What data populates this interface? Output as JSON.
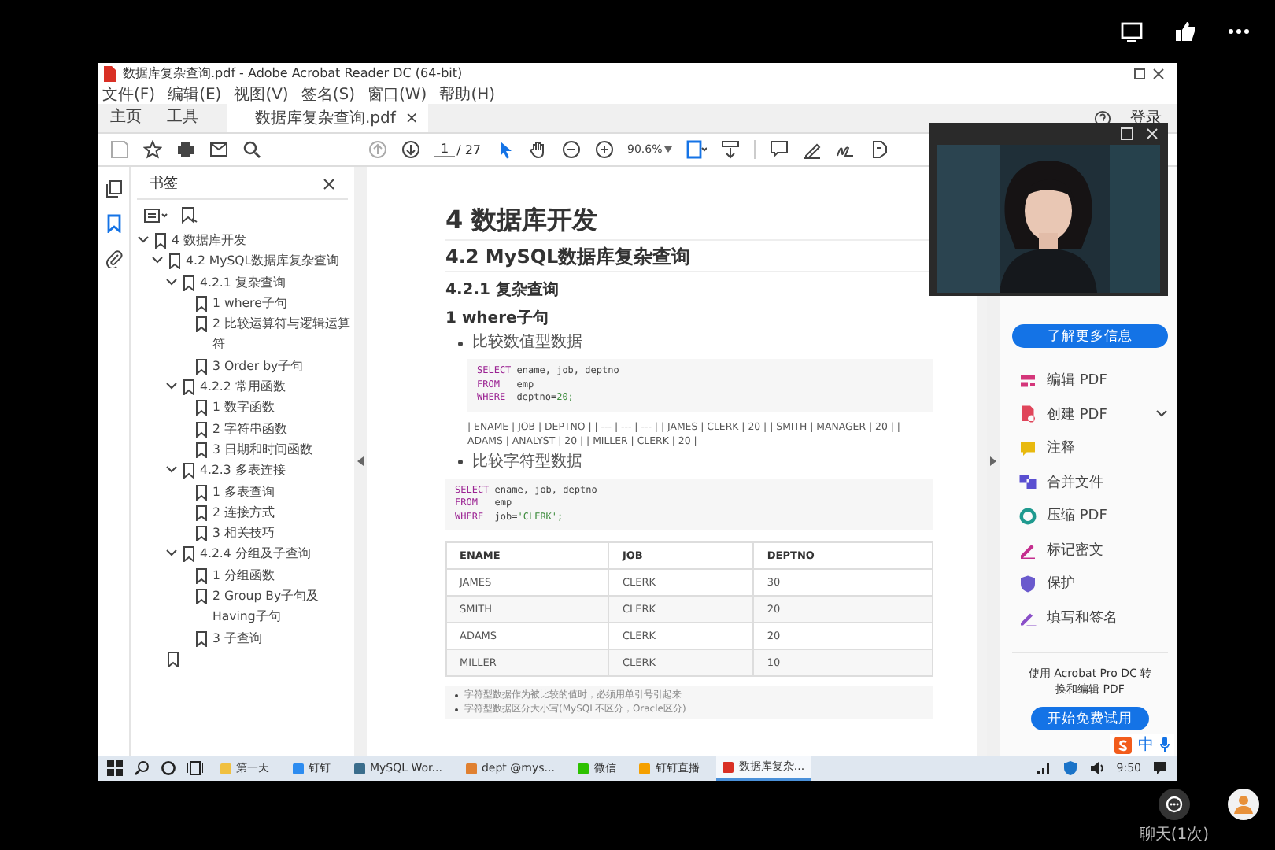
{
  "window": {
    "title": "数据库复杂查询.pdf - Adobe Acrobat Reader DC (64-bit)"
  },
  "menu": [
    "文件(F)",
    "编辑(E)",
    "视图(V)",
    "签名(S)",
    "窗口(W)",
    "帮助(H)"
  ],
  "tabs": [
    {
      "label": "主页",
      "selected": false
    },
    {
      "label": "工具",
      "selected": false
    }
  ],
  "document_tab": {
    "label": "数据库复杂查询.pdf",
    "close": "×"
  },
  "sign_in": "登录",
  "toolbar": {
    "page": "1",
    "page_count": "/ 27",
    "zoom": "90.6%"
  },
  "bookmarks": {
    "title": "书签",
    "items": [
      {
        "label": "4 数据库开发",
        "expanded": true,
        "children": [
          {
            "label": "4.2 MySQL数据库复杂查询",
            "expanded": true,
            "children": [
              {
                "label": "4.2.1 复杂查询",
                "expanded": true,
                "children": [
                  {
                    "label": "1 where子句"
                  },
                  {
                    "label": "2 比较运算符与逻辑运算符"
                  },
                  {
                    "label": "3 Order by子句"
                  }
                ]
              },
              {
                "label": "4.2.2 常用函数",
                "expanded": true,
                "children": [
                  {
                    "label": "1 数字函数"
                  },
                  {
                    "label": "2 字符串函数"
                  },
                  {
                    "label": "3 日期和时间函数"
                  }
                ]
              },
              {
                "label": "4.2.3 多表连接",
                "expanded": true,
                "children": [
                  {
                    "label": "1 多表查询"
                  },
                  {
                    "label": "2 连接方式"
                  },
                  {
                    "label": "3  相关技巧"
                  }
                ]
              },
              {
                "label": "4.2.4 分组及子查询",
                "expanded": true,
                "children": [
                  {
                    "label": "1 分组函数"
                  },
                  {
                    "label": "2 Group By子句及Having子句"
                  },
                  {
                    "label": "3 子查询"
                  }
                ]
              }
            ]
          }
        ]
      }
    ]
  },
  "document": {
    "h1": "4 数据库开发",
    "h2": "4.2 MySQL数据库复杂查询",
    "h3": "4.2.1 复杂查询",
    "h4": "1 where子句",
    "bullet_1": "比较数值型数据",
    "code_1": [
      {
        "keyword": "SELECT",
        "text": " ename, job, deptno"
      },
      {
        "keyword": "FROM",
        "text": "   emp"
      },
      {
        "keyword": "WHERE",
        "text": "  deptno=",
        "literal": "20;"
      }
    ],
    "paragraph": "| ENAME | JOB | DEPTNO | | --- | --- | --- | | JAMES | CLERK | 20 | | SMITH | MANAGER | 20 | | ADAMS | ANALYST | 20 | | MILLER | CLERK | 20 |",
    "bullet_2": "比较字符型数据",
    "code_2": [
      {
        "keyword": "SELECT",
        "text": " ename, job, deptno"
      },
      {
        "keyword": "FROM",
        "text": "   emp"
      },
      {
        "keyword": "WHERE",
        "text": "  job=",
        "literal": "'CLERK';"
      }
    ],
    "table": {
      "columns": [
        "ENAME",
        "JOB",
        "DEPTNO"
      ],
      "rows": [
        [
          "JAMES",
          "CLERK",
          "30"
        ],
        [
          "SMITH",
          "CLERK",
          "20"
        ],
        [
          "ADAMS",
          "CLERK",
          "20"
        ],
        [
          "MILLER",
          "CLERK",
          "10"
        ]
      ]
    },
    "notes": [
      "字符型数据作为被比较的值时，必须用单引号引起来",
      "字符型数据区分大小写(MySQL不区分，Oracle区分)"
    ]
  },
  "right_panel": {
    "learn_more": "了解更多信息",
    "tools": [
      {
        "label": "编辑 PDF",
        "color": "#d4367a",
        "has_menu": false
      },
      {
        "label": "创建 PDF",
        "color": "#e0455a",
        "has_menu": true
      },
      {
        "label": "注释",
        "color": "#e8b90f",
        "has_menu": false
      },
      {
        "label": "合并文件",
        "color": "#5a4fd1",
        "has_menu": false
      },
      {
        "label": "压缩 PDF",
        "color": "#1f9a8f",
        "has_menu": false
      },
      {
        "label": "标记密文",
        "color": "#c42d8e",
        "has_menu": false
      },
      {
        "label": "保护",
        "color": "#6a5acd",
        "has_menu": false
      },
      {
        "label": "填写和签名",
        "color": "#8a4fc8",
        "has_menu": false
      }
    ],
    "promo": "使用 Acrobat Pro DC 转换和编辑 PDF",
    "trial": "开始免费试用"
  },
  "ime": {
    "mode": "中"
  },
  "taskbar": {
    "apps": [
      {
        "label": "第一天",
        "color": "#f0c040",
        "selected": false
      },
      {
        "label": "钉钉",
        "color": "#2d8cf0",
        "selected": false
      },
      {
        "label": "MySQL Wor...",
        "color": "#3a6d8c",
        "selected": false
      },
      {
        "label": "dept @mys...",
        "color": "#e08030",
        "selected": false
      },
      {
        "label": "微信",
        "color": "#2dc100",
        "selected": false
      },
      {
        "label": "钉钉直播",
        "color": "#f5a000",
        "selected": false
      },
      {
        "label": "数据库复杂...",
        "color": "#d93025",
        "selected": true
      }
    ],
    "time": "9:50"
  },
  "meeting": {
    "chat_label": "聊天(1次)"
  }
}
